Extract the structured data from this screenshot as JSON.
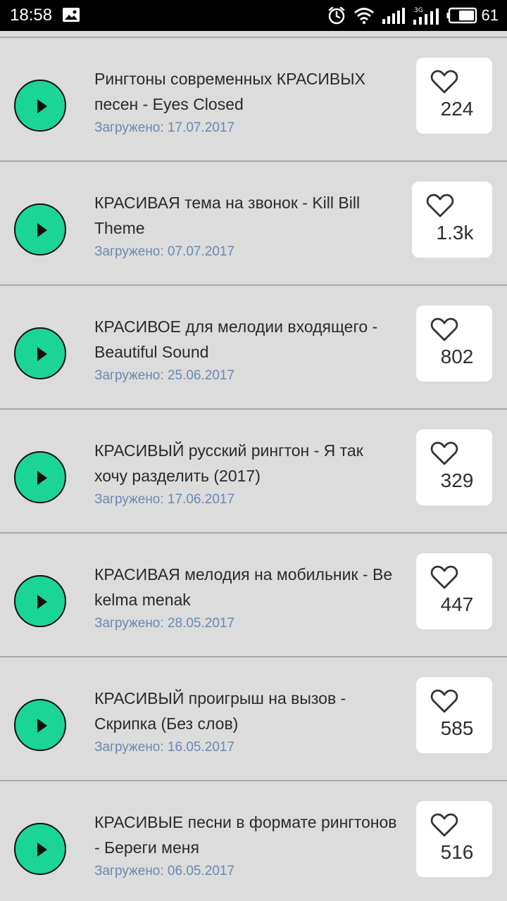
{
  "status_bar": {
    "time": "18:58",
    "battery_level": "61",
    "network_label": "3G",
    "icons": [
      "photo-icon",
      "alarm-icon",
      "wifi-icon",
      "signal-icon",
      "signal-3g-icon",
      "battery-icon"
    ]
  },
  "colors": {
    "play_button": "#1bd597",
    "date_text": "#6b88b0",
    "background": "#dcdcdc"
  },
  "ringtones": [
    {
      "title": "Рингтоны современных КРАСИВЫХ песен - Eyes Closed",
      "date": "Загружено: 17.07.2017",
      "likes": "224"
    },
    {
      "title": "КРАСИВАЯ тема на звонок - Kill Bill Theme",
      "date": "Загружено: 07.07.2017",
      "likes": "1.3k"
    },
    {
      "title": "КРАСИВОЕ для мелодии входящего - Beautiful Sound",
      "date": "Загружено: 25.06.2017",
      "likes": "802"
    },
    {
      "title": "КРАСИВЫЙ русский рингтон - Я так хочу разделить (2017)",
      "date": "Загружено: 17.06.2017",
      "likes": "329"
    },
    {
      "title": "КРАСИВАЯ мелодия на мобильник - Be kelma menak",
      "date": "Загружено: 28.05.2017",
      "likes": "447"
    },
    {
      "title": "КРАСИВЫЙ проигрыш на вызов - Скрипка (Без слов)",
      "date": "Загружено: 16.05.2017",
      "likes": "585"
    },
    {
      "title": "КРАСИВЫЕ песни в формате рингтонов - Береги меня",
      "date": "Загружено: 06.05.2017",
      "likes": "516"
    }
  ]
}
